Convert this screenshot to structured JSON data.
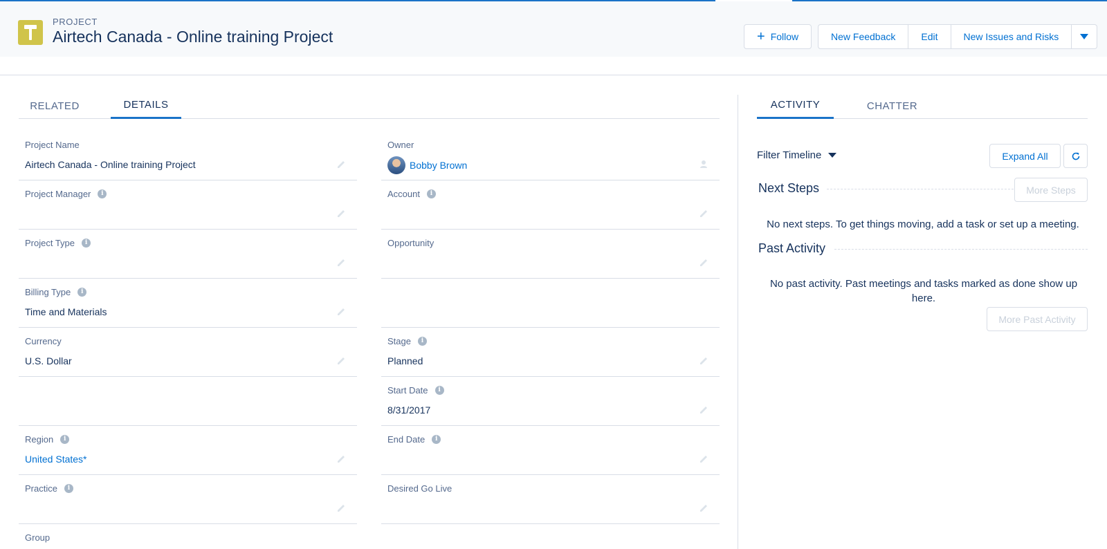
{
  "header": {
    "object_type": "PROJECT",
    "title": "Airtech Canada - Online training Project",
    "follow_label": "Follow",
    "actions": [
      "New Feedback",
      "Edit",
      "New Issues and Risks"
    ]
  },
  "left_tabs": [
    "RELATED",
    "DETAILS"
  ],
  "details": {
    "project_name": {
      "label": "Project Name",
      "value": "Airtech Canada - Online training Project"
    },
    "owner": {
      "label": "Owner",
      "value": "Bobby Brown"
    },
    "project_manager": {
      "label": "Project Manager",
      "value": ""
    },
    "account": {
      "label": "Account",
      "value": ""
    },
    "project_type": {
      "label": "Project Type",
      "value": ""
    },
    "opportunity": {
      "label": "Opportunity",
      "value": ""
    },
    "billing_type": {
      "label": "Billing Type",
      "value": "Time and Materials"
    },
    "currency": {
      "label": "Currency",
      "value": "U.S. Dollar"
    },
    "stage": {
      "label": "Stage",
      "value": "Planned"
    },
    "start_date": {
      "label": "Start Date",
      "value": "8/31/2017"
    },
    "region": {
      "label": "Region",
      "value": "United States*"
    },
    "end_date": {
      "label": "End Date",
      "value": ""
    },
    "practice": {
      "label": "Practice",
      "value": ""
    },
    "desired_go_live": {
      "label": "Desired Go Live",
      "value": ""
    },
    "group": {
      "label": "Group",
      "value": ""
    }
  },
  "right_tabs": [
    "ACTIVITY",
    "CHATTER"
  ],
  "activity": {
    "filter_label": "Filter Timeline",
    "expand_all": "Expand All",
    "next_steps_title": "Next Steps",
    "more_steps": "More Steps",
    "next_steps_empty": "No next steps. To get things moving, add a task or set up a meeting.",
    "past_activity_title": "Past Activity",
    "past_empty": "No past activity. Past meetings and tasks marked as done show up here.",
    "more_past": "More Past Activity"
  },
  "colors": {
    "brand": "#0070d2",
    "accent": "#1a73c8",
    "icon_bg": "#d0c44a",
    "text": "#16325c"
  }
}
